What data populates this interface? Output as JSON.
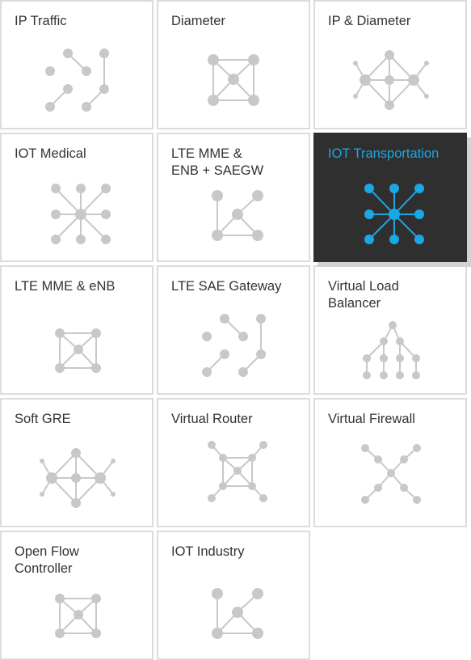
{
  "tiles": [
    {
      "label": "IP Traffic",
      "icon": "scattered-nodes-icon",
      "active": false
    },
    {
      "label": "Diameter",
      "icon": "square-network-icon",
      "active": false
    },
    {
      "label": "IP & Diameter",
      "icon": "diamond-network-icon",
      "active": false
    },
    {
      "label": "IOT Medical",
      "icon": "star-network-icon",
      "active": false
    },
    {
      "label": "LTE MME &\nENB + SAEGW",
      "icon": "triangle-network-icon",
      "active": false
    },
    {
      "label": "IOT Transportation",
      "icon": "star-network-icon",
      "active": true
    },
    {
      "label": "LTE MME & eNB",
      "icon": "box-network-icon",
      "active": false
    },
    {
      "label": "LTE SAE Gateway",
      "icon": "scattered-nodes-icon",
      "active": false
    },
    {
      "label": "Virtual Load\nBalancer",
      "icon": "tree-network-icon",
      "active": false
    },
    {
      "label": "Soft GRE",
      "icon": "diamond-network-icon",
      "active": false
    },
    {
      "label": "Virtual Router",
      "icon": "router-network-icon",
      "active": false
    },
    {
      "label": "Virtual Firewall",
      "icon": "x-network-icon",
      "active": false
    },
    {
      "label": "Open Flow\nController",
      "icon": "box-network-icon",
      "active": false
    },
    {
      "label": "IOT Industry",
      "icon": "triangle-network-icon",
      "active": false
    }
  ],
  "colors": {
    "accent": "#1ba7e4",
    "active_background": "#2f2f2f",
    "node": "#c8c8c8",
    "border": "#dcdcdc",
    "label": "#333333"
  }
}
